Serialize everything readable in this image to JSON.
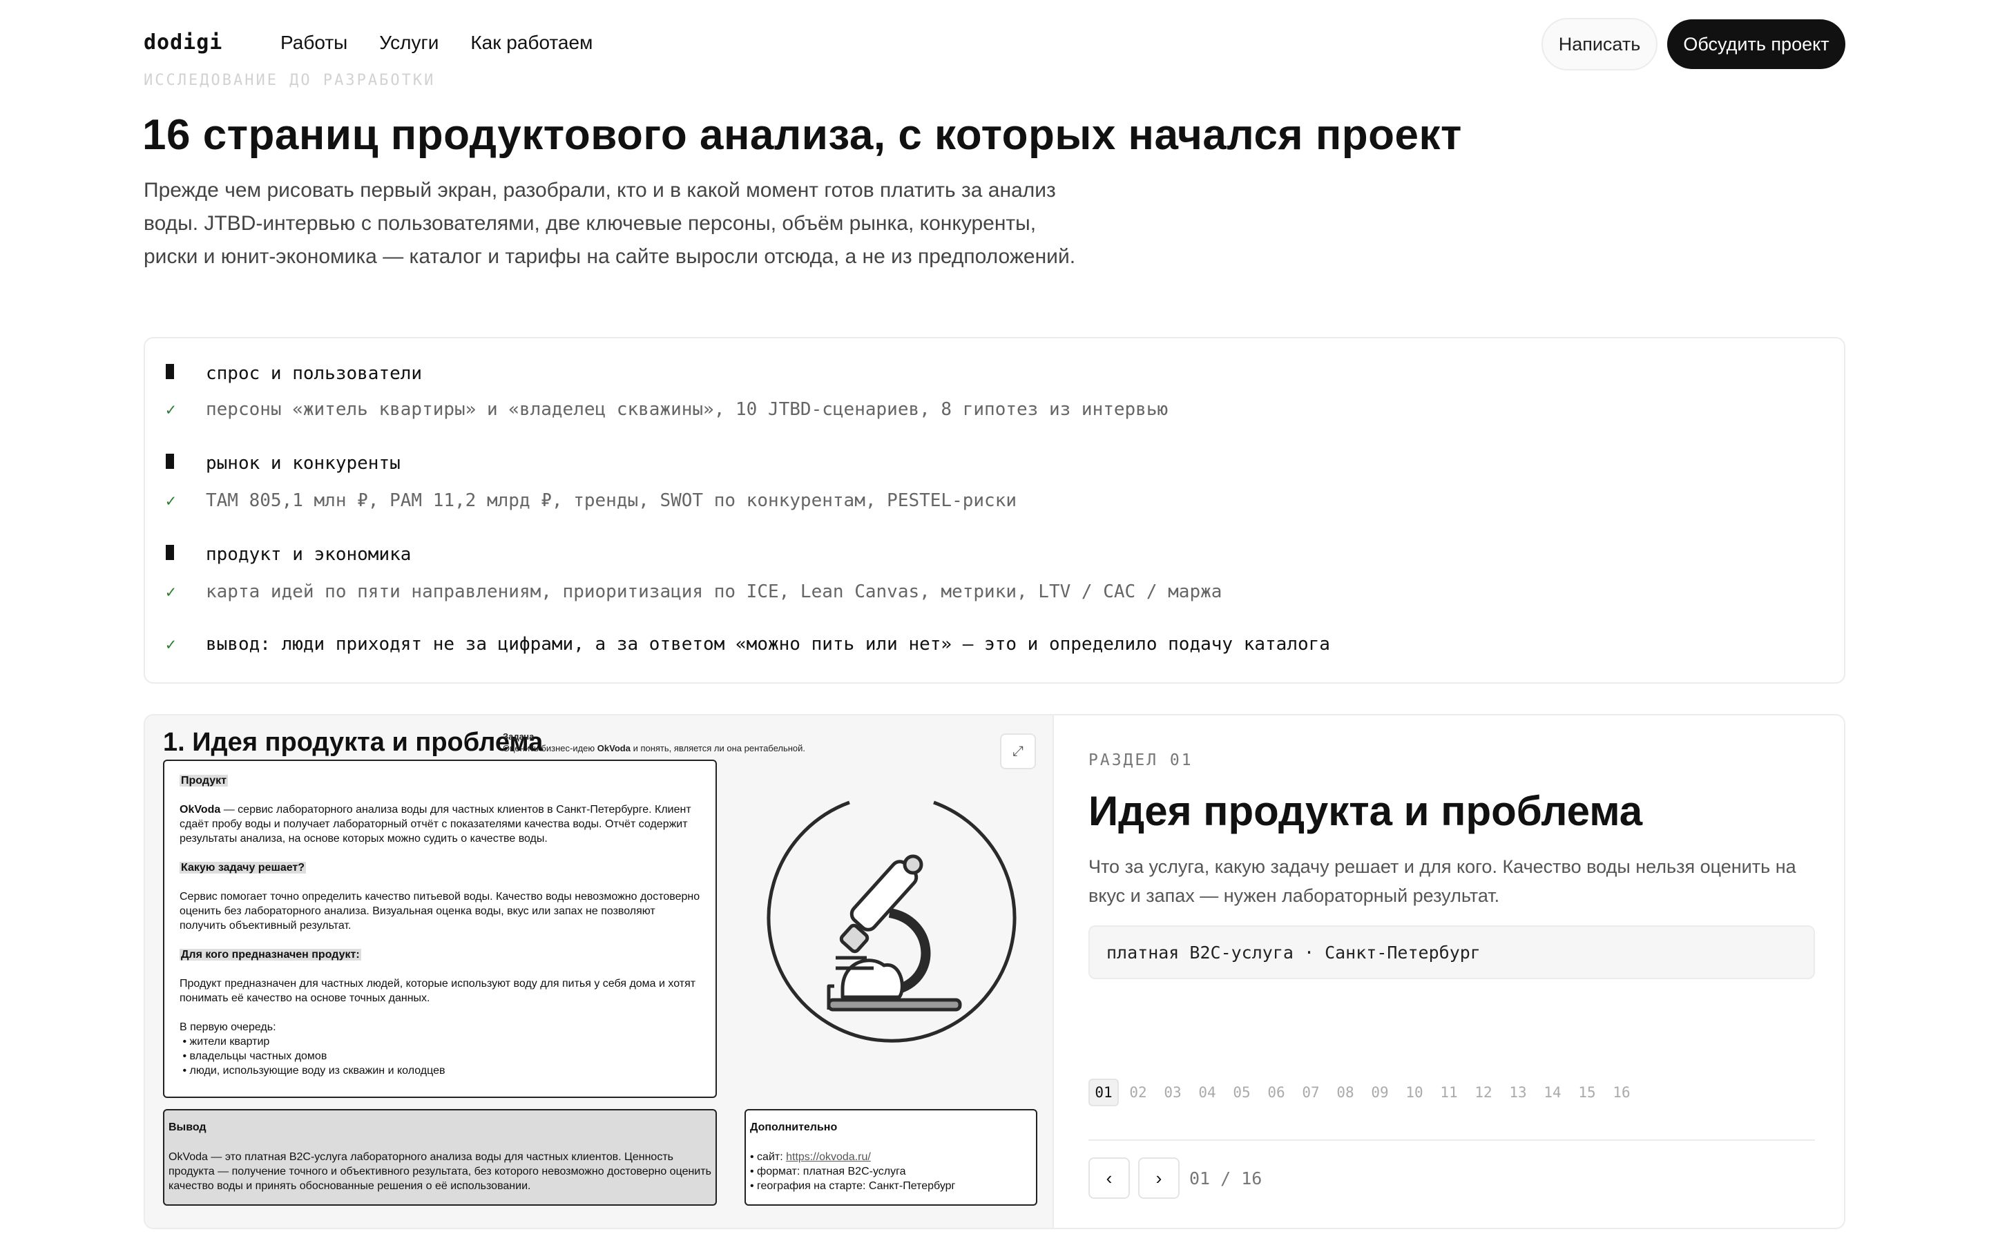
{
  "header": {
    "logo": "dodigi",
    "nav": [
      "Работы",
      "Услуги",
      "Как работаем"
    ],
    "write_label": "Написать",
    "discuss_label": "Обсудить проект"
  },
  "hero": {
    "eyebrow": "ИССЛЕДОВАНИЕ ДО РАЗРАБОТКИ",
    "title": "16 страниц продуктового анализа, с которых начался проект",
    "lead": "Прежде чем рисовать первый экран, разобрали, кто и в какой момент готов платить за анализ воды. JTBD-интервью с пользователями, две ключевые персоны, объём рынка, конкуренты, риски и юнит-экономика — каталог и тарифы на сайте выросли отсюда, а не из предположений."
  },
  "checklist": {
    "groups": [
      {
        "head": "спрос и пользователи",
        "detail": "персоны «житель квартиры» и «владелец скважины», 10 JTBD-сценариев, 8 гипотез из интервью"
      },
      {
        "head": "рынок и конкуренты",
        "detail": "TAM 805,1 млн ₽, PAM 11,2 млрд ₽, тренды, SWOT по конкурентам, PESTEL-риски"
      },
      {
        "head": "продукт и экономика",
        "detail": "карта идей по пяти направлениям, приоритизация по ICE, Lean Canvas, метрики, LTV / CAC / маржа"
      }
    ],
    "conclusion": "вывод: люди приходят не за цифрами, а за ответом «можно пить или нет» — это и определило подачу каталога"
  },
  "slide": {
    "title": "1. Идея продукта и проблема",
    "task_label": "Задача",
    "task_text_1": "Оценить бизнес-идею ",
    "task_brand": "OkVoda",
    "task_text_2": " и понять, является ли она рентабельной.",
    "product_label": "Продукт",
    "product_brand": "OkVoda",
    "product_text": " — сервис лабораторного анализа воды для частных клиентов в Санкт-Петербурге. Клиент сдаёт пробу воды и получает лабораторный отчёт с показателями качества воды. Отчёт содержит результаты анализа, на основе которых можно судить о качестве воды.",
    "task_q": "Какую задачу решает?",
    "task_a": "Сервис помогает точно определить качество питьевой воды. Качество воды невозможно достоверно оценить без лабораторного анализа. Визуальная оценка воды, вкус или запах не позволяют получить объективный результат.",
    "audience_q": "Для кого предназначен продукт:",
    "audience_a": "Продукт предназначен для частных людей, которые используют воду для питья у себя дома и хотят понимать её качество на основе точных данных.",
    "priority_label": "В первую очередь:",
    "priority_items": [
      "жители квартир",
      "владельцы частных домов",
      "люди, использующие воду из скважин и колодцев"
    ],
    "conclusion_label": "Вывод",
    "conclusion_text": "OkVoda — это платная B2C-услуга лабораторного анализа воды для частных клиентов. Ценность продукта — получение точного и объективного результата, без которого невозможно достоверно оценить качество воды и принять обоснованные решения о её использовании.",
    "extra_label": "Дополнительно",
    "extra_site_prefix": "• сайт: ",
    "extra_site": "https://okvoda.ru/",
    "extra_format": "• формат: платная B2C-услуга",
    "extra_geo": "• география на старте: Санкт-Петербург",
    "expand_icon": "⤢"
  },
  "section": {
    "label": "РАЗДЕЛ 01",
    "title": "Идея продукта и проблема",
    "desc": "Что за услуга, какую задачу решает и для кого. Качество воды нельзя оценить на вкус и запах — нужен лабораторный результат.",
    "tag": "платная B2C-услуга · Санкт-Петербург",
    "pages": [
      "01",
      "02",
      "03",
      "04",
      "05",
      "06",
      "07",
      "08",
      "09",
      "10",
      "11",
      "12",
      "13",
      "14",
      "15",
      "16"
    ],
    "active_page": "01",
    "prev": "‹",
    "next": "›",
    "counter": "01 / 16"
  }
}
